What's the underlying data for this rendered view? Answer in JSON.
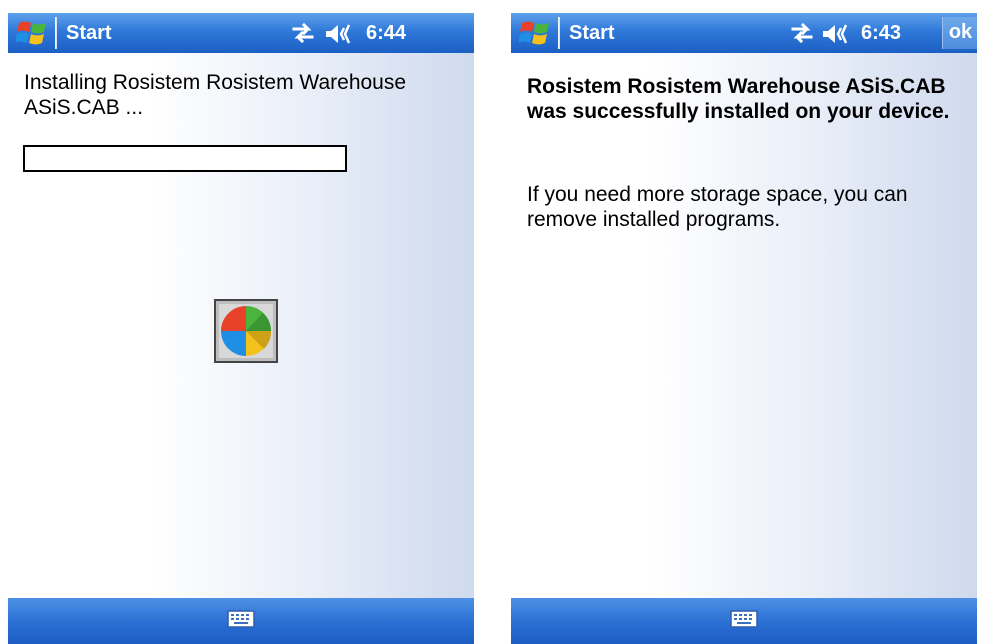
{
  "left_screen": {
    "taskbar": {
      "start_label": "Start",
      "time": "6:44"
    },
    "message": "Installing Rosistem Rosistem Warehouse ASiS.CAB ...",
    "progress_percent": 0
  },
  "right_screen": {
    "taskbar": {
      "start_label": "Start",
      "time": "6:43",
      "ok_label": "ok"
    },
    "success_message": "Rosistem Rosistem Warehouse ASiS.CAB was successfully installed on your device.",
    "info_message": "If you need more storage space, you can remove installed programs."
  },
  "colors": {
    "taskbar_blue": "#2f79d9",
    "logo_red": "#e8432a",
    "logo_green": "#4bb43c",
    "logo_blue": "#1f8fe6",
    "logo_yellow": "#f5c11c"
  },
  "icons": [
    "windows-logo-icon",
    "connectivity-icon",
    "volume-icon",
    "keyboard-icon",
    "busy-icon"
  ]
}
